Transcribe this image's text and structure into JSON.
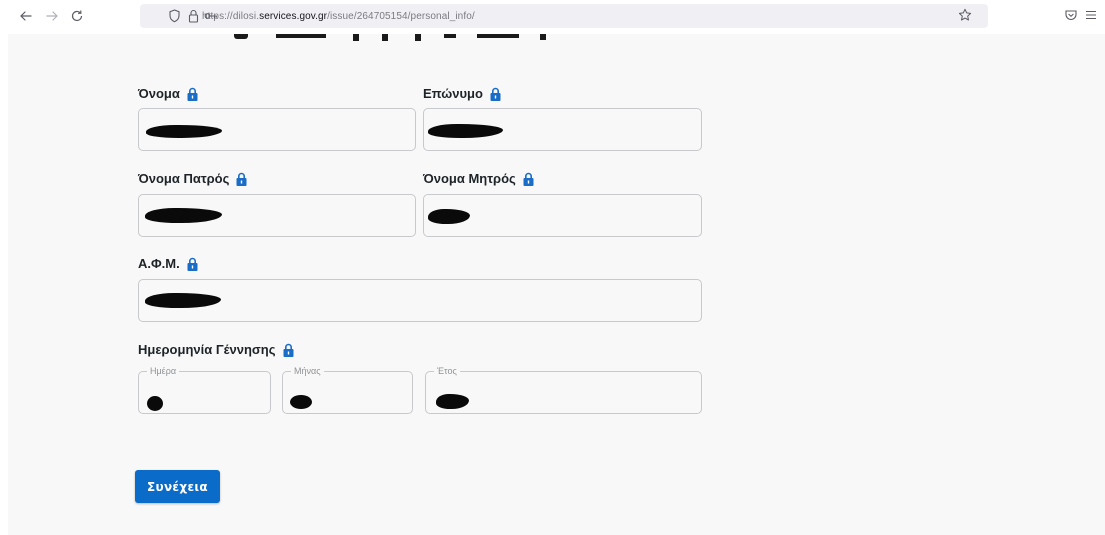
{
  "browser": {
    "url_prefix": "https://dilosi.",
    "url_host": "services.gov.gr",
    "url_path": "/issue/264705154/personal_info/"
  },
  "form": {
    "first_name_label": "Όνομα",
    "last_name_label": "Επώνυμο",
    "father_name_label": "Όνομα Πατρός",
    "mother_name_label": "Όνομα Μητρός",
    "tax_id_label": "Α.Φ.Μ.",
    "birth_date_label": "Ημερομηνία Γέννησης",
    "day_legend": "Ημέρα",
    "month_legend": "Μήνας",
    "year_legend": "Έτος",
    "continue_label": "Συνέχεια"
  },
  "colors": {
    "accent": "#0b6bc8",
    "lock": "#1a6dc7"
  },
  "icons": {
    "back": "arrow-left-icon",
    "forward": "arrow-right-icon",
    "reload": "reload-icon",
    "shield": "shield-icon",
    "padlock": "padlock-icon",
    "permissions": "key-icon",
    "bookmark": "star-icon",
    "pocket": "pocket-icon",
    "menu": "hamburger-menu-icon",
    "field_lock": "lock-icon"
  }
}
